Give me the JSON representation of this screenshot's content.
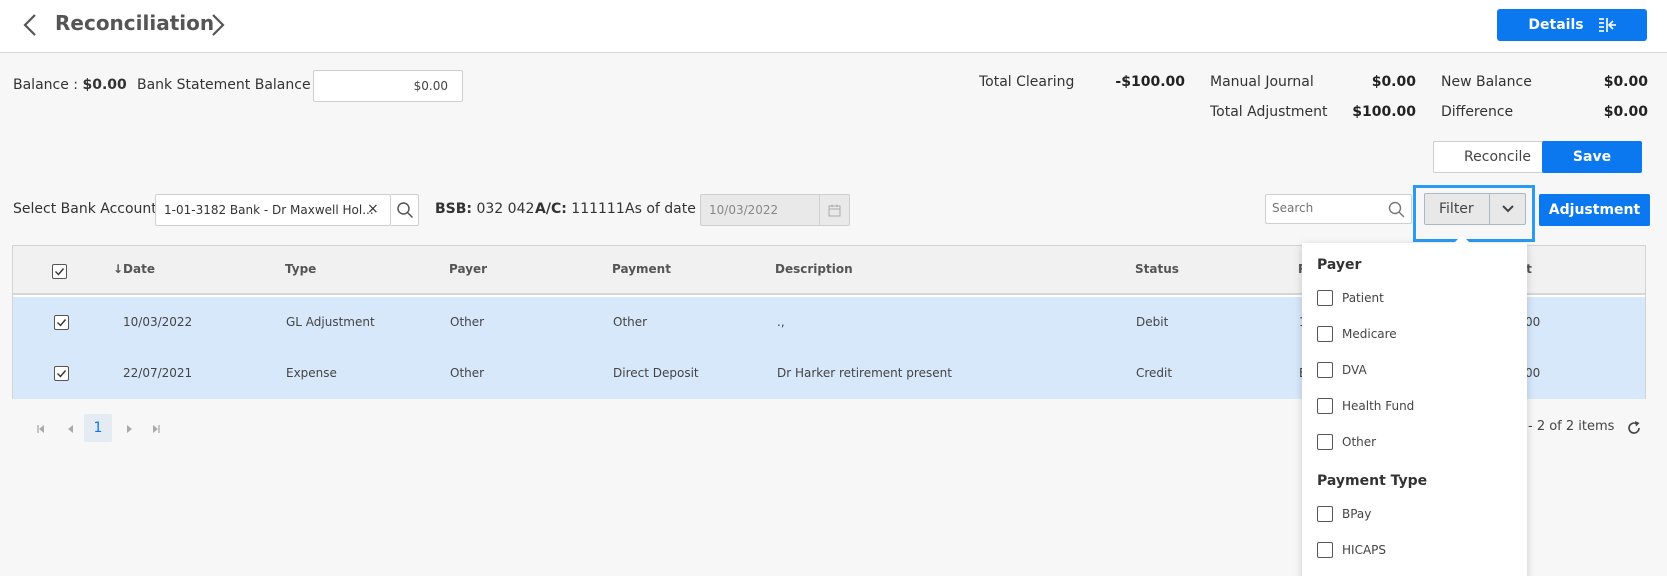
{
  "header": {
    "title": "Reconciliation",
    "details_label": "Details"
  },
  "balances": {
    "balance_label": "Balance :",
    "balance_value": "$0.00",
    "statement_label": "Bank Statement Balance :",
    "statement_value": "$0.00"
  },
  "summary": {
    "total_clearing_label": "Total Clearing",
    "total_clearing_value": "-$100.00",
    "manual_journal_label": "Manual Journal",
    "manual_journal_value": "$0.00",
    "new_balance_label": "New Balance",
    "new_balance_value": "$0.00",
    "total_adjustment_label": "Total Adjustment",
    "total_adjustment_value": "$100.00",
    "difference_label": "Difference",
    "difference_value": "$0.00"
  },
  "actions": {
    "reconcile_label": "Reconcile",
    "save_label": "Save"
  },
  "filters": {
    "select_bank_label": "Select Bank Account",
    "bank_value": "1-01-3182 Bank - Dr Maxwell Hol...",
    "clear_glyph": "×",
    "bsb_label": "BSB:",
    "bsb_value": "032 042",
    "ac_label": "A/C:",
    "ac_value": "111111",
    "as_of_label": "As of date",
    "as_of_value": "10/03/2022",
    "search_placeholder": "Search",
    "filter_label": "Filter",
    "adjustment_label": "Adjustment"
  },
  "table": {
    "columns": {
      "date": "↓Date",
      "type": "Type",
      "payer": "Payer",
      "payment": "Payment",
      "description": "Description",
      "status": "Status",
      "ref_partial": "R",
      "amount_partial": "unt"
    },
    "rows": [
      {
        "date": "10/03/2022",
        "type": "GL Adjustment",
        "payer": "Other",
        "payment": "Other",
        "description": ".,",
        "status": "Debit",
        "ref_partial": "1",
        "amount_partial": "00"
      },
      {
        "date": "22/07/2021",
        "type": "Expense",
        "payer": "Other",
        "payment": "Direct Deposit",
        "description": "Dr Harker retirement present",
        "status": "Credit",
        "ref_partial": "B",
        "amount_partial": "00"
      }
    ]
  },
  "pager": {
    "current_page": "1",
    "items_text": "- 2 of 2 items"
  },
  "dropdown": {
    "payer_title": "Payer",
    "payer_options": [
      "Patient",
      "Medicare",
      "DVA",
      "Health Fund",
      "Other"
    ],
    "payment_type_title": "Payment Type",
    "payment_type_options": [
      "BPay",
      "HICAPS"
    ]
  },
  "colors": {
    "primary": "#0b78f0",
    "row_selected": "#d7e8fb",
    "focus_outline": "#2b9af3"
  }
}
